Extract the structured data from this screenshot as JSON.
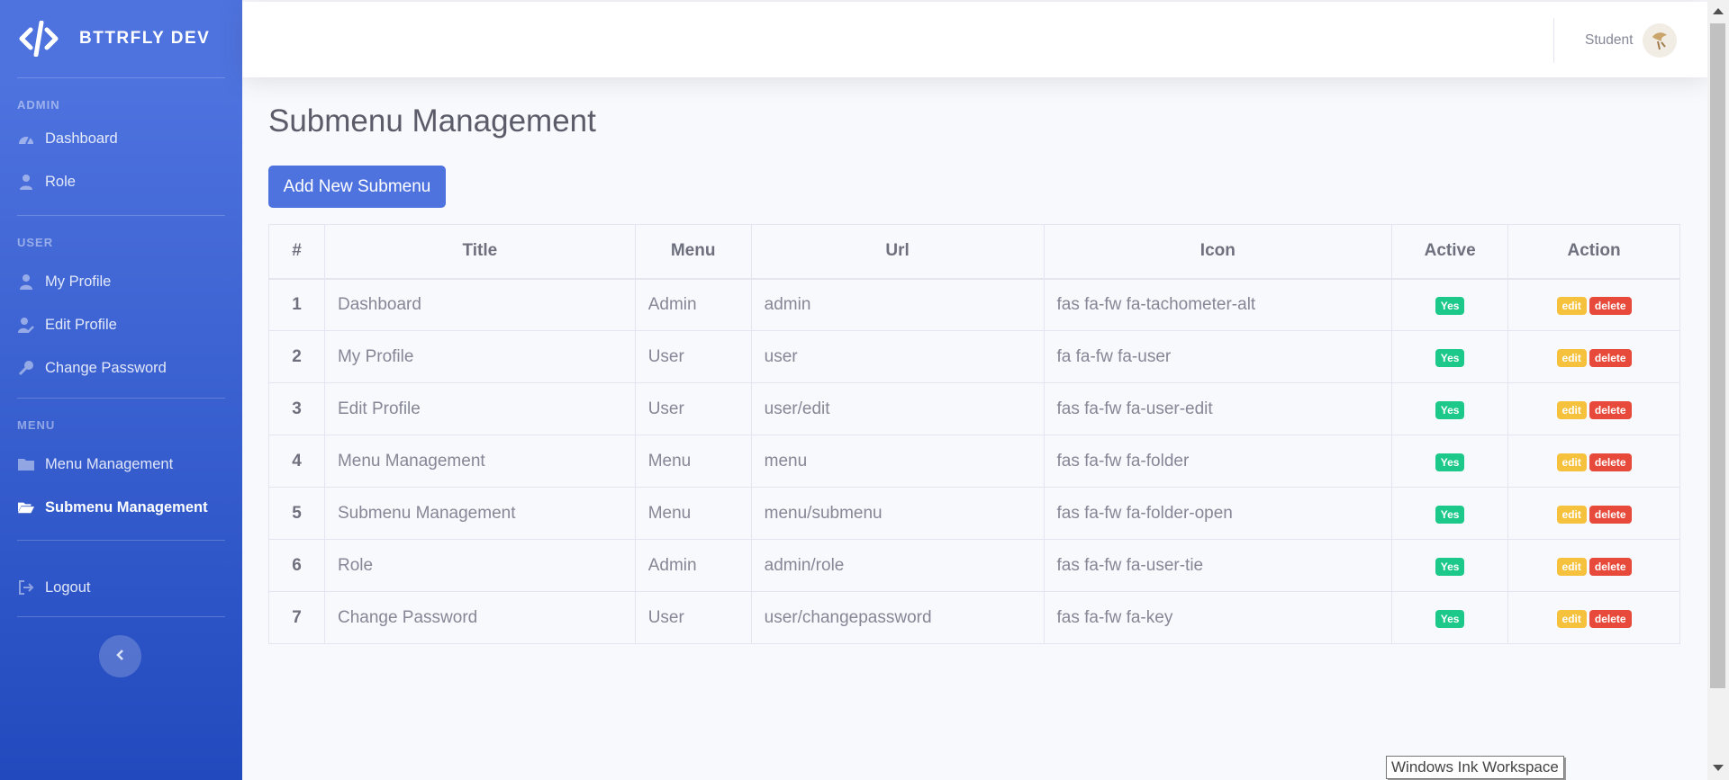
{
  "brand": {
    "name": "BTTRFLY DEV"
  },
  "sidebar": {
    "sections": [
      {
        "heading": "ADMIN",
        "items": [
          {
            "label": "Dashboard",
            "icon": "tachometer-icon"
          },
          {
            "label": "Role",
            "icon": "user-tie-icon"
          }
        ]
      },
      {
        "heading": "USER",
        "items": [
          {
            "label": "My Profile",
            "icon": "user-icon"
          },
          {
            "label": "Edit Profile",
            "icon": "user-edit-icon"
          },
          {
            "label": "Change Password",
            "icon": "key-icon"
          }
        ]
      },
      {
        "heading": "MENU",
        "items": [
          {
            "label": "Menu Management",
            "icon": "folder-icon"
          },
          {
            "label": "Submenu Management",
            "icon": "folder-open-icon",
            "active": true
          }
        ]
      }
    ],
    "logout": {
      "label": "Logout",
      "icon": "sign-out-icon"
    },
    "toggle_icon": "chevron-left-icon"
  },
  "topbar": {
    "user_name": "Student",
    "avatar_icon": "avatar"
  },
  "main": {
    "title": "Submenu Management",
    "add_button": "Add New Submenu",
    "table": {
      "headers": [
        "#",
        "Title",
        "Menu",
        "Url",
        "Icon",
        "Active",
        "Action"
      ],
      "rows": [
        {
          "num": "1",
          "title": "Dashboard",
          "menu": "Admin",
          "url": "admin",
          "icon": "fas fa-fw fa-tachometer-alt",
          "active": "Yes",
          "edit": "edit",
          "delete": "delete"
        },
        {
          "num": "2",
          "title": "My Profile",
          "menu": "User",
          "url": "user",
          "icon": "fa fa-fw fa-user",
          "active": "Yes",
          "edit": "edit",
          "delete": "delete"
        },
        {
          "num": "3",
          "title": "Edit Profile",
          "menu": "User",
          "url": "user/edit",
          "icon": "fas fa-fw fa-user-edit",
          "active": "Yes",
          "edit": "edit",
          "delete": "delete"
        },
        {
          "num": "4",
          "title": "Menu Management",
          "menu": "Menu",
          "url": "menu",
          "icon": "fas fa-fw fa-folder",
          "active": "Yes",
          "edit": "edit",
          "delete": "delete"
        },
        {
          "num": "5",
          "title": "Submenu Management",
          "menu": "Menu",
          "url": "menu/submenu",
          "icon": "fas fa-fw fa-folder-open",
          "active": "Yes",
          "edit": "edit",
          "delete": "delete"
        },
        {
          "num": "6",
          "title": "Role",
          "menu": "Admin",
          "url": "admin/role",
          "icon": "fas fa-fw fa-user-tie",
          "active": "Yes",
          "edit": "edit",
          "delete": "delete"
        },
        {
          "num": "7",
          "title": "Change Password",
          "menu": "User",
          "url": "user/changepassword",
          "icon": "fas fa-fw fa-key",
          "active": "Yes",
          "edit": "edit",
          "delete": "delete"
        }
      ]
    }
  },
  "tooltip": {
    "text": "Windows Ink Workspace"
  },
  "colors": {
    "primary": "#4e73df",
    "success": "#1cc88a",
    "warning": "#f6c23e",
    "danger": "#e74a3b"
  }
}
